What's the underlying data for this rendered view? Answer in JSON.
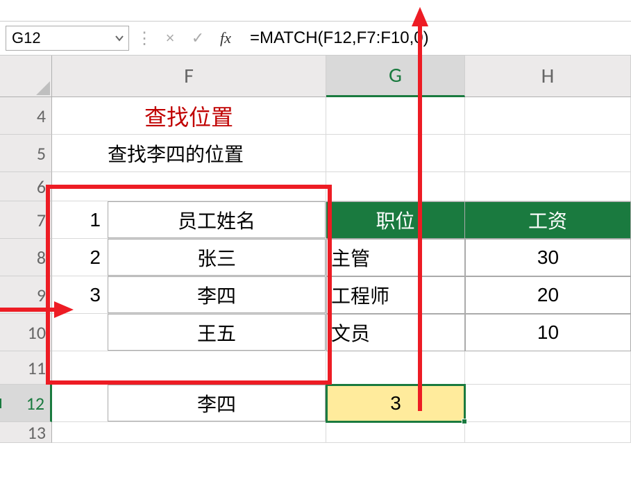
{
  "name_box": "G12",
  "formula_bar": {
    "cancel_icon": "×",
    "enter_icon": "✓",
    "fx_label": "fx",
    "formula": "=MATCH(F12,F7:F10,0)"
  },
  "columns": [
    "F",
    "G",
    "H"
  ],
  "row_numbers": [
    "4",
    "5",
    "6",
    "7",
    "8",
    "9",
    "10",
    "11",
    "12",
    "13"
  ],
  "selected_col": "G",
  "selected_row": "12",
  "title": "查找位置",
  "subtitle": "查找李四的位置",
  "row_labels": {
    "r7": "1",
    "r8": "2",
    "r9": "3"
  },
  "headers": {
    "F": "员工姓名",
    "G": "职位",
    "H": "工资"
  },
  "data_rows": [
    {
      "name": "张三",
      "role": "主管",
      "salary": "30"
    },
    {
      "name": "李四",
      "role": "工程师",
      "salary": "20",
      "highlight": true
    },
    {
      "name": "王五",
      "role": "文员",
      "salary": "10"
    }
  ],
  "lookup": {
    "name": "李四",
    "result": "3"
  }
}
